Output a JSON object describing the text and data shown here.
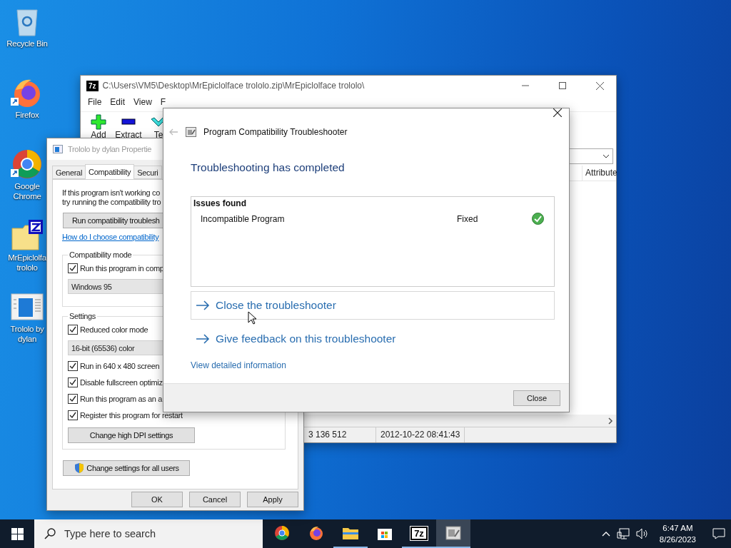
{
  "desktop_icons": [
    {
      "kind": "recycle",
      "label": "Recycle Bin",
      "shortcut": false
    },
    {
      "kind": "firefox",
      "label": "Firefox",
      "shortcut": true
    },
    {
      "kind": "chrome",
      "label": "Google Chrome",
      "shortcut": true
    },
    {
      "kind": "archive",
      "label": "MrEpiclolfa trololo",
      "shortcut": false
    },
    {
      "kind": "program",
      "label": "Trololo by dylan",
      "shortcut": false
    }
  ],
  "archive_window": {
    "logo": "7z",
    "title": "C:\\Users\\VM5\\Desktop\\MrEpiclolface trololo.zip\\MrEpiclolface trololo\\",
    "menu": [
      "File",
      "Edit",
      "View",
      "F"
    ],
    "toolbar": [
      {
        "kind": "add",
        "label": "Add"
      },
      {
        "kind": "extract",
        "label": "Extract"
      },
      {
        "kind": "test",
        "label": "Te"
      }
    ],
    "column_header": "Attribute",
    "status": [
      "3 136 512",
      "2012-10-22 08:41:43"
    ]
  },
  "properties_window": {
    "title": "Trololo by dylan Propertie",
    "tabs": [
      {
        "label": "General",
        "selected": false
      },
      {
        "label": "Compatibility",
        "selected": true
      },
      {
        "label": "Securi",
        "selected": false
      }
    ],
    "intro": [
      "If this program isn't working co",
      "try running the compatibility tro"
    ],
    "troubleshoot_button": "Run compatibility troublesh",
    "help_link": "How do I choose compatibility",
    "compat_mode": {
      "title": "Compatibility mode",
      "checkbox": {
        "label": "Run this program in comp",
        "checked": true
      },
      "select": "Windows 95"
    },
    "settings": {
      "title": "Settings",
      "items": [
        {
          "kind": "checkbox",
          "label": "Reduced color mode",
          "checked": true
        },
        {
          "kind": "select",
          "label": "16-bit (65536) color"
        },
        {
          "kind": "checkbox",
          "label": "Run in 640 x 480 screen",
          "checked": true
        },
        {
          "kind": "checkbox",
          "label": "Disable fullscreen optimiz",
          "checked": true
        },
        {
          "kind": "checkbox",
          "label": "Run this program as an a",
          "checked": true
        },
        {
          "kind": "checkbox",
          "label": "Register this program for restart",
          "checked": true
        }
      ],
      "dpi_button": "Change high DPI settings"
    },
    "all_users_button": "Change settings for all users",
    "buttons": [
      "OK",
      "Cancel",
      "Apply"
    ]
  },
  "troubleshooter": {
    "title": "Program Compatibility Troubleshooter",
    "heading": "Troubleshooting has completed",
    "issues": {
      "title": "Issues found",
      "rows": [
        {
          "name": "Incompatible Program",
          "status": "Fixed",
          "fixed": true
        }
      ]
    },
    "actions": [
      {
        "label": "Close the troubleshooter",
        "selected": true
      },
      {
        "label": "Give feedback on this troubleshooter",
        "selected": false
      }
    ],
    "details_link": "View detailed information",
    "close_button": "Close"
  },
  "taskbar": {
    "search": {
      "placeholder": "Type here to search"
    },
    "apps": [
      {
        "kind": "chrome",
        "running": false,
        "selected": false
      },
      {
        "kind": "firefox",
        "running": false,
        "selected": false
      },
      {
        "kind": "explorer",
        "running": true,
        "selected": false
      },
      {
        "kind": "store",
        "running": false,
        "selected": false
      },
      {
        "kind": "sevenzip",
        "label": "7z",
        "running": true,
        "selected": false
      },
      {
        "kind": "troubleshooter",
        "running": true,
        "selected": true
      }
    ],
    "clock": {
      "time": "6:47 AM",
      "date": "8/26/2023"
    }
  }
}
